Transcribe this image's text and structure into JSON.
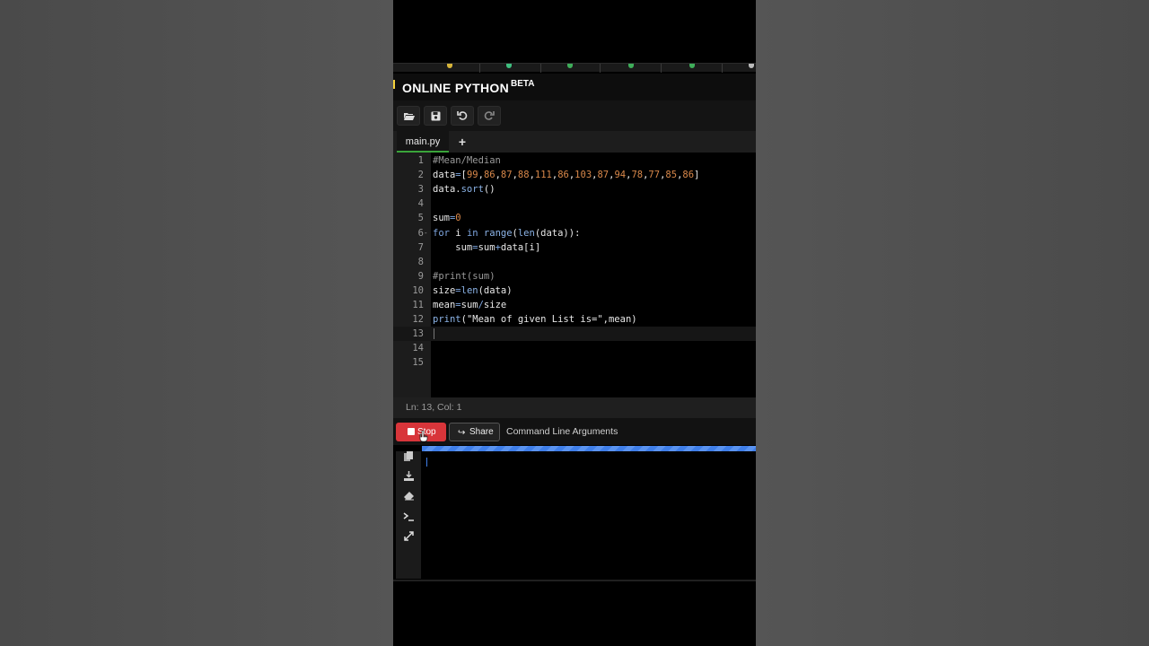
{
  "app": {
    "title": "ONLINE PYTHON",
    "badge": "BETA"
  },
  "toolbar": {
    "open_icon": "folder-open-icon",
    "save_icon": "save-icon",
    "undo_icon": "undo-icon",
    "redo_icon": "redo-icon"
  },
  "tabs": {
    "active": "main.py",
    "add_label": "+"
  },
  "editor": {
    "line_numbers": [
      "1",
      "2",
      "3",
      "4",
      "5",
      "6",
      "7",
      "8",
      "9",
      "10",
      "11",
      "12",
      "13",
      "14",
      "15"
    ],
    "lines": [
      "#Mean/Median",
      "data=[99,86,87,88,111,86,103,87,94,78,77,85,86]",
      "data.sort()",
      "",
      "sum=0",
      "for i in range(len(data)):",
      "    sum=sum+data[i]",
      "",
      "#print(sum)",
      "size=len(data)",
      "mean=sum/size",
      "print(\"Mean of given List is=\",mean)",
      "",
      "",
      ""
    ],
    "active_line": 13,
    "fold_markers": {
      "6": "-"
    }
  },
  "status": {
    "position": "Ln: 13,  Col: 1"
  },
  "runbar": {
    "stop_label": "Stop",
    "share_label": "Share",
    "args_label": "Command Line Arguments"
  },
  "console_tools": [
    "copy-icon",
    "download-icon",
    "eraser-icon",
    "terminal-icon",
    "expand-icon"
  ],
  "colors": {
    "stop": "#d8353a",
    "progress": "#3f7ee8",
    "number": "#d9884a",
    "keyword": "#7ea6e0"
  }
}
